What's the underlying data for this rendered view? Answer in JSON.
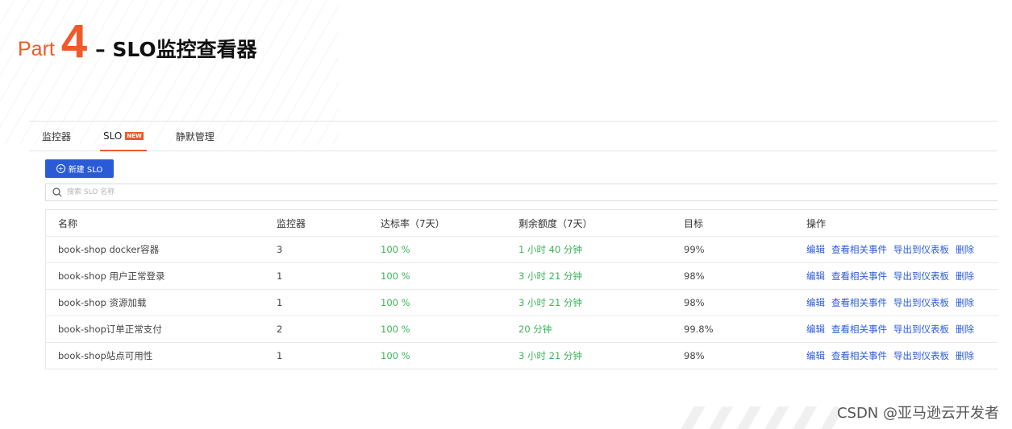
{
  "header": {
    "part_word": "Part",
    "part_number": "4",
    "title": "– SLO监控查看器"
  },
  "tabs": [
    {
      "label": "监控器",
      "active": false
    },
    {
      "label": "SLO",
      "badge": "NEW",
      "active": true
    },
    {
      "label": "静默管理",
      "active": false
    }
  ],
  "toolbar": {
    "new_button_label": "新建 SLO",
    "search_placeholder": "搜索 SLO 名称"
  },
  "table": {
    "headers": [
      "名称",
      "监控器",
      "达标率（7天）",
      "剩余额度（7天）",
      "目标",
      "操作"
    ],
    "rows": [
      {
        "name": "book-shop docker容器",
        "monitors": "3",
        "rate": "100 %",
        "remaining": "1 小时 40 分钟",
        "target": "99%"
      },
      {
        "name": "book-shop 用户正常登录",
        "monitors": "1",
        "rate": "100 %",
        "remaining": "3 小时 21 分钟",
        "target": "98%"
      },
      {
        "name": "book-shop 资源加载",
        "monitors": "1",
        "rate": "100 %",
        "remaining": "3 小时 21 分钟",
        "target": "98%"
      },
      {
        "name": "book-shop订单正常支付",
        "monitors": "2",
        "rate": "100 %",
        "remaining": "20 分钟",
        "target": "99.8%"
      },
      {
        "name": "book-shop站点可用性",
        "monitors": "1",
        "rate": "100 %",
        "remaining": "3 小时 21 分钟",
        "target": "98%"
      }
    ],
    "actions": [
      "编辑",
      "查看相关事件",
      "导出到仪表板",
      "删除"
    ]
  },
  "watermark": "CSDN @亚马逊云开发者",
  "colors": {
    "accent": "#f05a28",
    "primary": "#2a5bd7",
    "success": "#3cb35a"
  }
}
